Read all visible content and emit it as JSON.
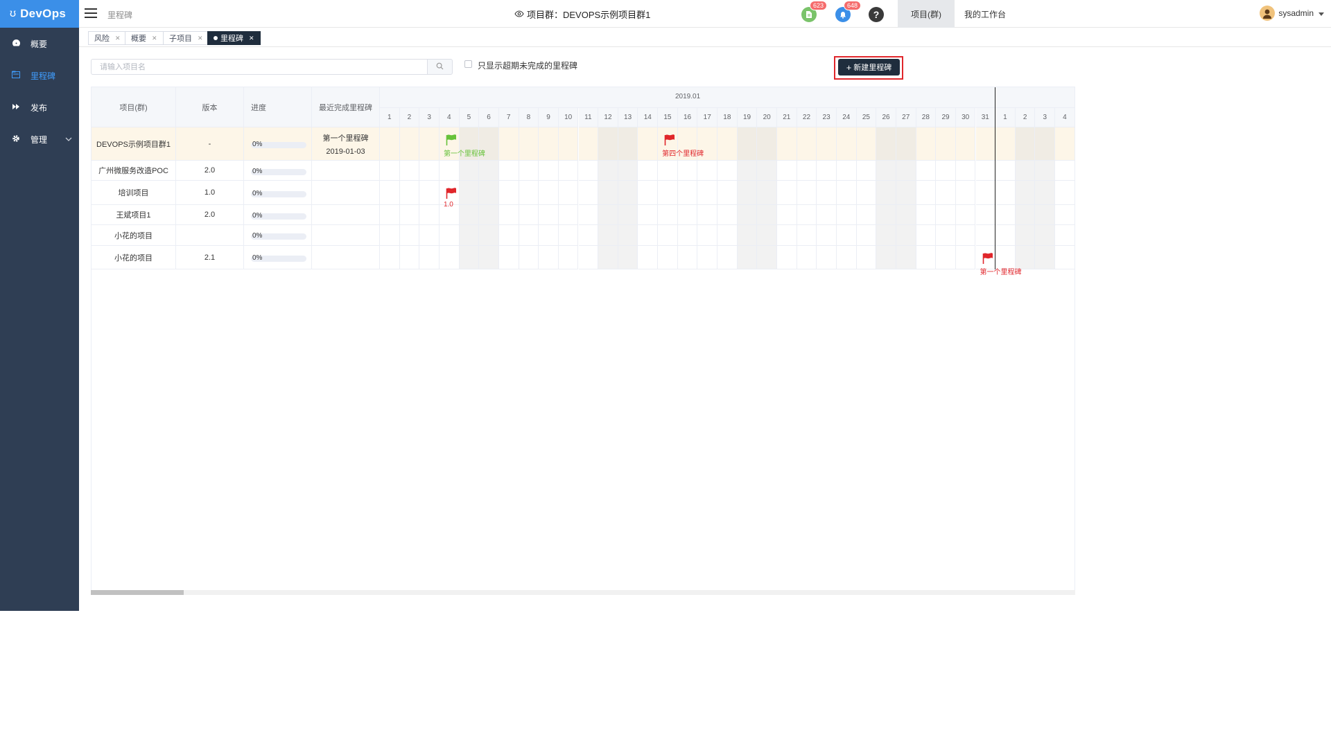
{
  "brand": {
    "name": "DevOps"
  },
  "sidebar": {
    "items": [
      {
        "label": "概要",
        "icon": "dashboard-icon"
      },
      {
        "label": "里程碑",
        "icon": "milestone-icon",
        "active": true
      },
      {
        "label": "发布",
        "icon": "release-icon"
      },
      {
        "label": "管理",
        "icon": "gear-icon",
        "has_submenu": true
      }
    ]
  },
  "header": {
    "breadcrumb": "里程碑",
    "title": "项目群：DEVOPS示例项目群1",
    "task_badge": "623",
    "bell_badge": "648",
    "help": "?",
    "tabs": [
      "项目(群)",
      "我的工作台"
    ],
    "user": "sysadmin"
  },
  "tags": [
    {
      "label": "风险",
      "active": false
    },
    {
      "label": "概要",
      "active": false
    },
    {
      "label": "子项目",
      "active": false
    },
    {
      "label": "里程碑",
      "active": true
    }
  ],
  "toolbar": {
    "search_placeholder": "请输入项目名",
    "only_overdue_label": "只显示超期未完成的里程碑",
    "new_button": "新建里程碑"
  },
  "table": {
    "columns": [
      "项目(群)",
      "版本",
      "进度",
      "最近完成里程碑"
    ],
    "month": "2019.01",
    "days": [
      "1",
      "2",
      "3",
      "4",
      "5",
      "6",
      "7",
      "8",
      "9",
      "10",
      "11",
      "12",
      "13",
      "14",
      "15",
      "16",
      "17",
      "18",
      "19",
      "20",
      "21",
      "22",
      "23",
      "24",
      "25",
      "26",
      "27",
      "28",
      "29",
      "30",
      "31",
      "1",
      "2",
      "3",
      "4"
    ],
    "weekend_day_indices": [
      4,
      5,
      11,
      12,
      18,
      19,
      25,
      26,
      32,
      33
    ],
    "rows": [
      {
        "project": "DEVOPS示例项目群1",
        "version": "-",
        "progress": "0%",
        "latest_name": "第一个里程碑",
        "latest_date": "2019-01-03",
        "highlight": true
      },
      {
        "project": "广州微服务改造POC",
        "version": "2.0",
        "progress": "0%",
        "latest_name": "",
        "latest_date": ""
      },
      {
        "project": "培训项目",
        "version": "1.0",
        "progress": "0%",
        "latest_name": "",
        "latest_date": ""
      },
      {
        "project": "王斌项目1",
        "version": "2.0",
        "progress": "0%",
        "latest_name": "",
        "latest_date": ""
      },
      {
        "project": "小花的项目",
        "version": "",
        "progress": "0%",
        "latest_name": "",
        "latest_date": ""
      },
      {
        "project": "小花的项目",
        "version": "2.1",
        "progress": "0%",
        "latest_name": "",
        "latest_date": ""
      }
    ],
    "milestones": [
      {
        "row": 0,
        "day_index": 3,
        "label": "第一个里程碑",
        "color": "#67c23a"
      },
      {
        "row": 0,
        "day_index": 14,
        "label": "第四个里程碑",
        "color": "#e0262b"
      },
      {
        "row": 2,
        "day_index": 3,
        "label": "1.0",
        "color": "#e0262b"
      },
      {
        "row": 5,
        "day_index": 30,
        "label": "第一个里程碑",
        "color": "#e0262b"
      }
    ]
  },
  "colors": {
    "sidebar": "#2f3e54",
    "brand": "#3b8fe8",
    "active_nav": "#409eff",
    "highlight_row": "#fdf6e8",
    "weekend": "#f2f2f2"
  }
}
